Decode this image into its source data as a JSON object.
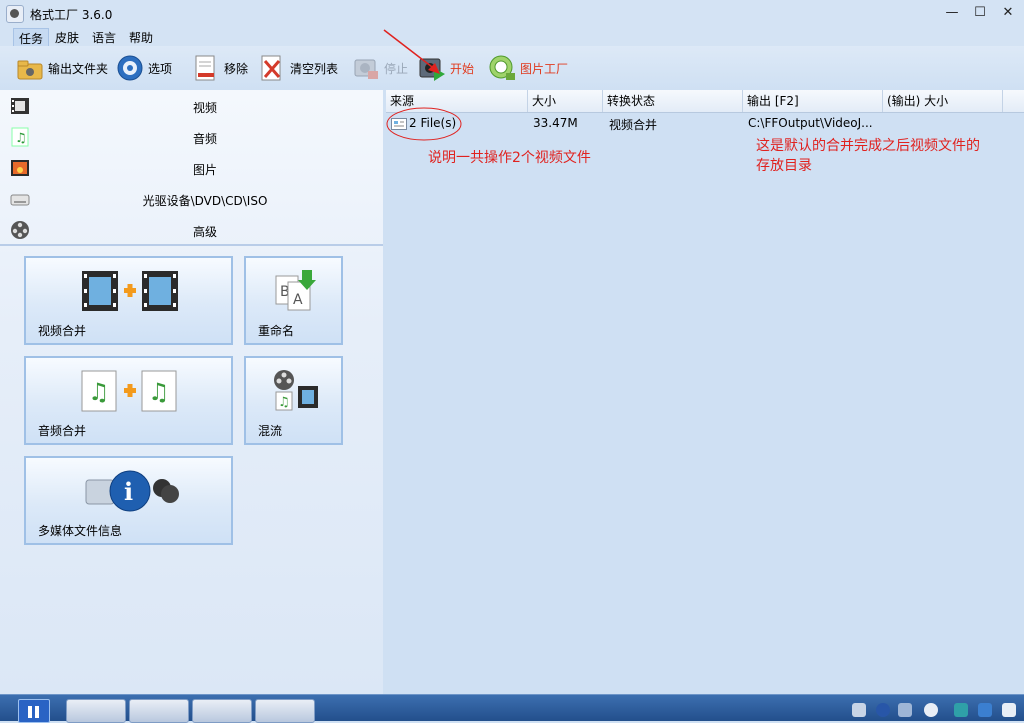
{
  "window": {
    "title": "格式工厂 3.6.0",
    "controls": [
      "—",
      "☐",
      "✕"
    ]
  },
  "menu": {
    "items": [
      "任务",
      "皮肤",
      "语言",
      "帮助"
    ]
  },
  "toolbar": {
    "output_folder": "输出文件夹",
    "options": "选项",
    "remove": "移除",
    "clear_list": "清空列表",
    "stop": "停止",
    "start": "开始",
    "picture_factory": "图片工厂"
  },
  "categories": [
    "视频",
    "音频",
    "图片",
    "光驱设备\\DVD\\CD\\ISO",
    "高级"
  ],
  "tasks": {
    "video_join": "视频合并",
    "rename": "重命名",
    "audio_join": "音频合并",
    "mux": "混流",
    "media_info": "多媒体文件信息"
  },
  "table": {
    "headers": [
      "来源",
      "大小",
      "转换状态",
      "输出 [F2]",
      "(输出) 大小"
    ],
    "rows": [
      {
        "source": "2 File(s)",
        "size": "33.47M",
        "status": "视频合并",
        "output": "C:\\FFOutput\\VideoJ...",
        "out_size": ""
      }
    ]
  },
  "annotations": {
    "files_note": "说明一共操作2个视频文件",
    "output_note_line1": "这是默认的合并完成之后视频文件的",
    "output_note_line2": "存放目录"
  },
  "colors": {
    "annotation": "#e0221f",
    "start_label": "#e03a1e",
    "window_bg": "#cfe0f3"
  }
}
